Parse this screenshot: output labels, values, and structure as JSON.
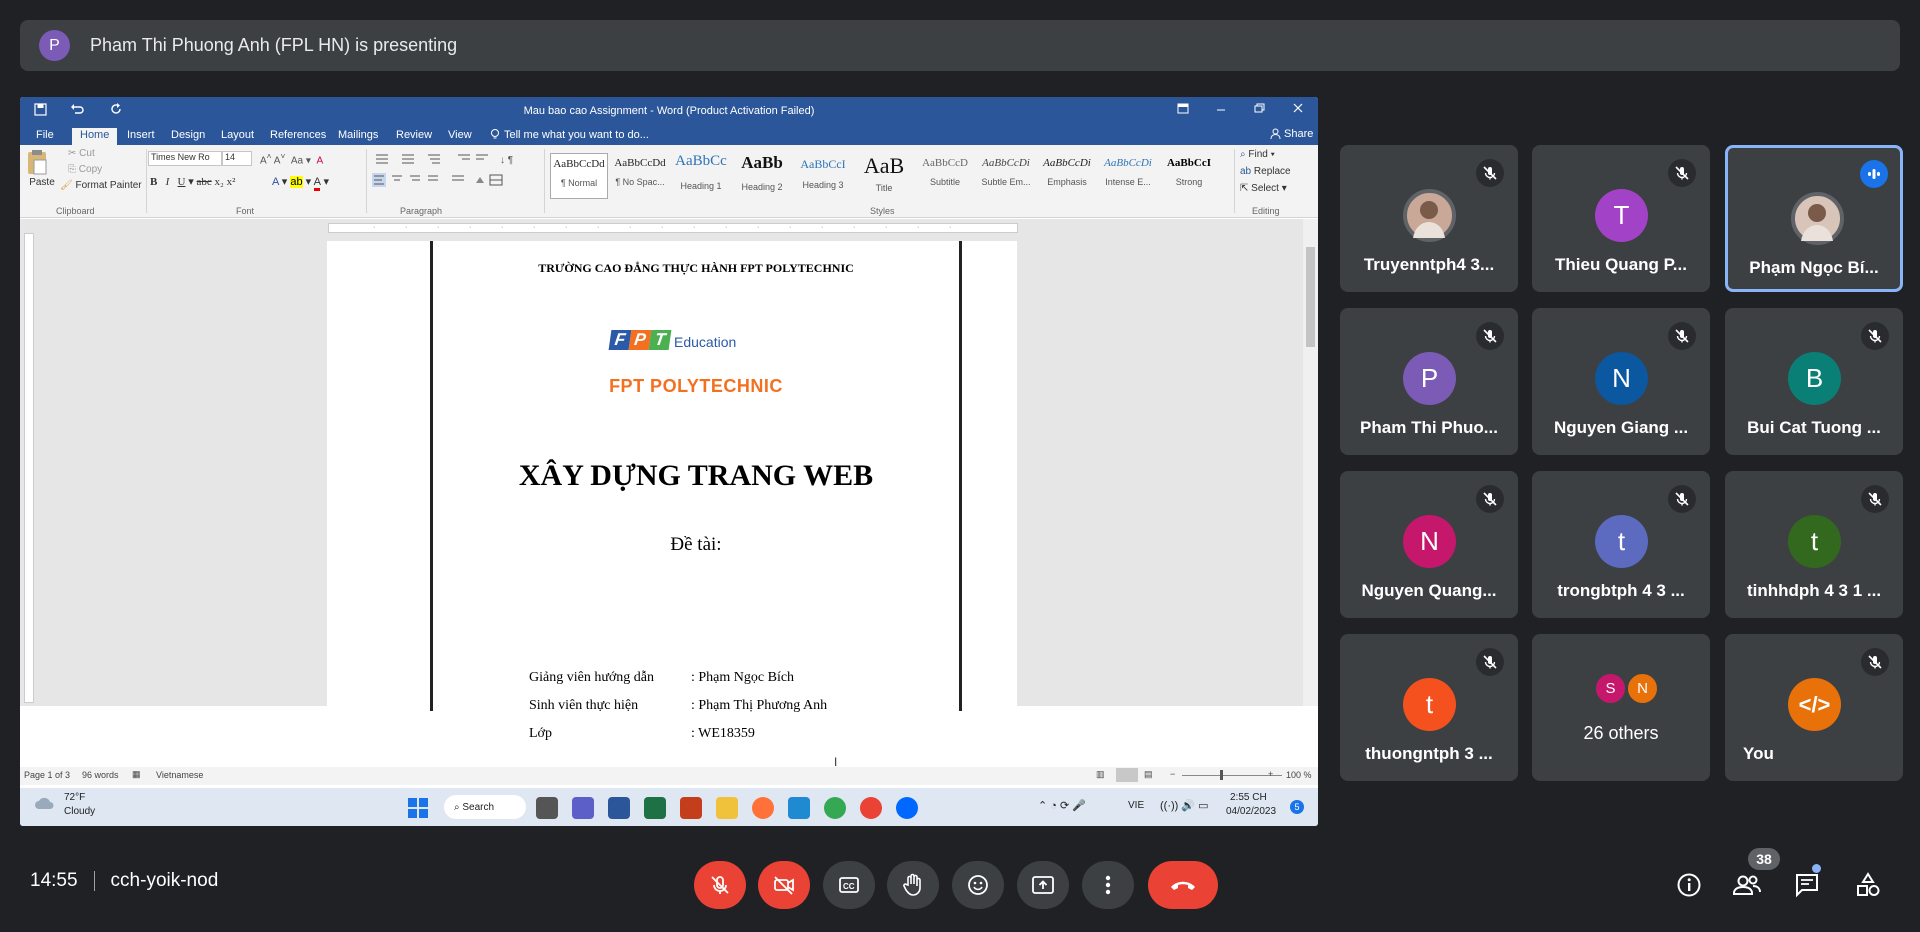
{
  "banner": {
    "avatar_letter": "P",
    "text": "Pham Thi Phuong Anh (FPL HN) is presenting"
  },
  "word": {
    "title": "Mau bao cao Assignment - Word (Product Activation Failed)",
    "tabs": [
      "File",
      "Home",
      "Insert",
      "Design",
      "Layout",
      "References",
      "Mailings",
      "Review",
      "View"
    ],
    "tell_me": "Tell me what you want to do...",
    "share": "Share",
    "window_buttons": [
      "Restore Down",
      "Replace"
    ],
    "clipboard": {
      "paste": "Paste",
      "cut": "Cut",
      "copy": "Copy",
      "format_painter": "Format Painter",
      "label": "Clipboard"
    },
    "font": {
      "name": "Times New Ro",
      "size": "14",
      "label": "Font"
    },
    "paragraph_label": "Paragraph",
    "styles_label": "Styles",
    "editing": {
      "find": "Find",
      "replace": "Replace",
      "select": "Select",
      "label": "Editing"
    },
    "styles": [
      {
        "sample": "AaBbCcDd",
        "name": "¶ Normal"
      },
      {
        "sample": "AaBbCcDd",
        "name": "¶ No Spac..."
      },
      {
        "sample": "AaBbCc",
        "name": "Heading 1"
      },
      {
        "sample": "AaBb",
        "name": "Heading 2"
      },
      {
        "sample": "AaBbCcI",
        "name": "Heading 3"
      },
      {
        "sample": "AaB",
        "name": "Title"
      },
      {
        "sample": "AaBbCcD",
        "name": "Subtitle"
      },
      {
        "sample": "AaBbCcDi",
        "name": "Subtle Em..."
      },
      {
        "sample": "AaBbCcDi",
        "name": "Emphasis"
      },
      {
        "sample": "AaBbCcDi",
        "name": "Intense E..."
      },
      {
        "sample": "AaBbCcI",
        "name": "Strong"
      }
    ],
    "doc": {
      "school": "TRƯỜNG CAO ĐẲNG THỰC HÀNH FPT POLYTECHNIC",
      "logo_fpt": "FPT",
      "logo_edu": "Education",
      "logo_poly": "FPT POLYTECHNIC",
      "heading": "XÂY DỰNG TRANG WEB",
      "subject": "Đề tài:",
      "rows": [
        {
          "label": "Giảng viên hướng dẫn",
          "value": ": Phạm Ngọc Bích"
        },
        {
          "label": "Sinh viên thực hiện",
          "value": ": Phạm Thị Phương Anh"
        },
        {
          "label": "Lớp",
          "value": ": WE18359"
        }
      ]
    },
    "status": {
      "page": "Page 1 of 3",
      "words": "96 words",
      "lang": "Vietnamese",
      "zoom": "100 %"
    },
    "taskbar": {
      "temp": "72°F",
      "weather": "Cloudy",
      "search": "Search",
      "lang": "VIE",
      "time": "2:55 CH",
      "date": "04/02/2023",
      "badge": "5"
    }
  },
  "tiles": [
    {
      "name": "Truyenntph4 3...",
      "initial": "",
      "color": "#c9a898",
      "muted": true,
      "photo": true
    },
    {
      "name": "Thieu Quang P...",
      "initial": "T",
      "color": "#a142c7",
      "muted": true
    },
    {
      "name": "Phạm Ngọc Bí...",
      "initial": "",
      "color": "#d8c4b8",
      "muted": false,
      "photo": true,
      "speaking": true
    },
    {
      "name": "Pham Thi Phuo...",
      "initial": "P",
      "color": "#7b5bb6",
      "muted": true
    },
    {
      "name": "Nguyen Giang ...",
      "initial": "N",
      "color": "#0b57a0",
      "muted": true
    },
    {
      "name": "Bui Cat Tuong ...",
      "initial": "B",
      "color": "#0a7f76",
      "muted": true
    },
    {
      "name": "Nguyen Quang...",
      "initial": "N",
      "color": "#c5186c",
      "muted": true
    },
    {
      "name": "trongbtph 4 3 ...",
      "initial": "t",
      "color": "#5c6bc0",
      "muted": true
    },
    {
      "name": "tinhhdph 4 3 1 ...",
      "initial": "t",
      "color": "#33691e",
      "muted": true
    },
    {
      "name": "thuongntph 3 ...",
      "initial": "t",
      "color": "#f4511e",
      "muted": true
    },
    {
      "name": "26 others",
      "initials": [
        "S",
        "N"
      ],
      "colors": [
        "#c5186c",
        "#e8710a"
      ]
    },
    {
      "name": "You",
      "initial": "</>",
      "color": "#e8710a",
      "muted": true
    }
  ],
  "bottom": {
    "time": "14:55",
    "code": "cch-yoik-nod",
    "participants": "38"
  }
}
